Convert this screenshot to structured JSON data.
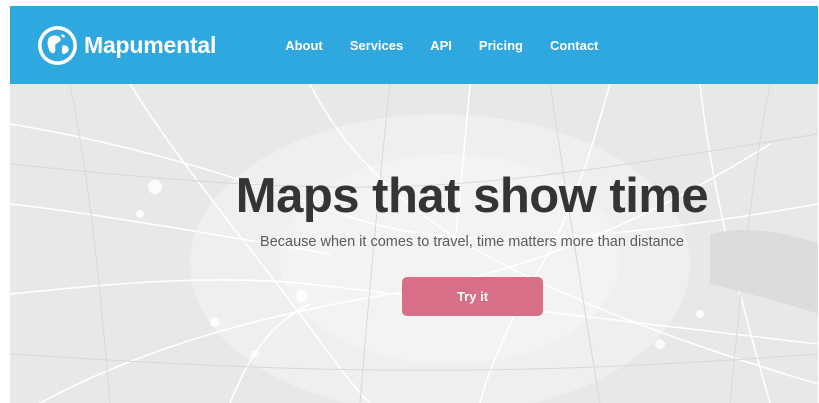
{
  "header": {
    "brand_name": "Mapumental",
    "logo_icon": "globe-icon",
    "nav": [
      {
        "label": "About"
      },
      {
        "label": "Services"
      },
      {
        "label": "API"
      },
      {
        "label": "Pricing"
      },
      {
        "label": "Contact"
      }
    ]
  },
  "hero": {
    "title": "Maps that show time",
    "subtitle": "Because when it comes to travel, time matters more than distance",
    "cta_label": "Try it",
    "background_icon": "map-background"
  },
  "colors": {
    "nav_background": "#2fa8e0",
    "cta_background": "#d96e87",
    "title_text": "#343434"
  }
}
